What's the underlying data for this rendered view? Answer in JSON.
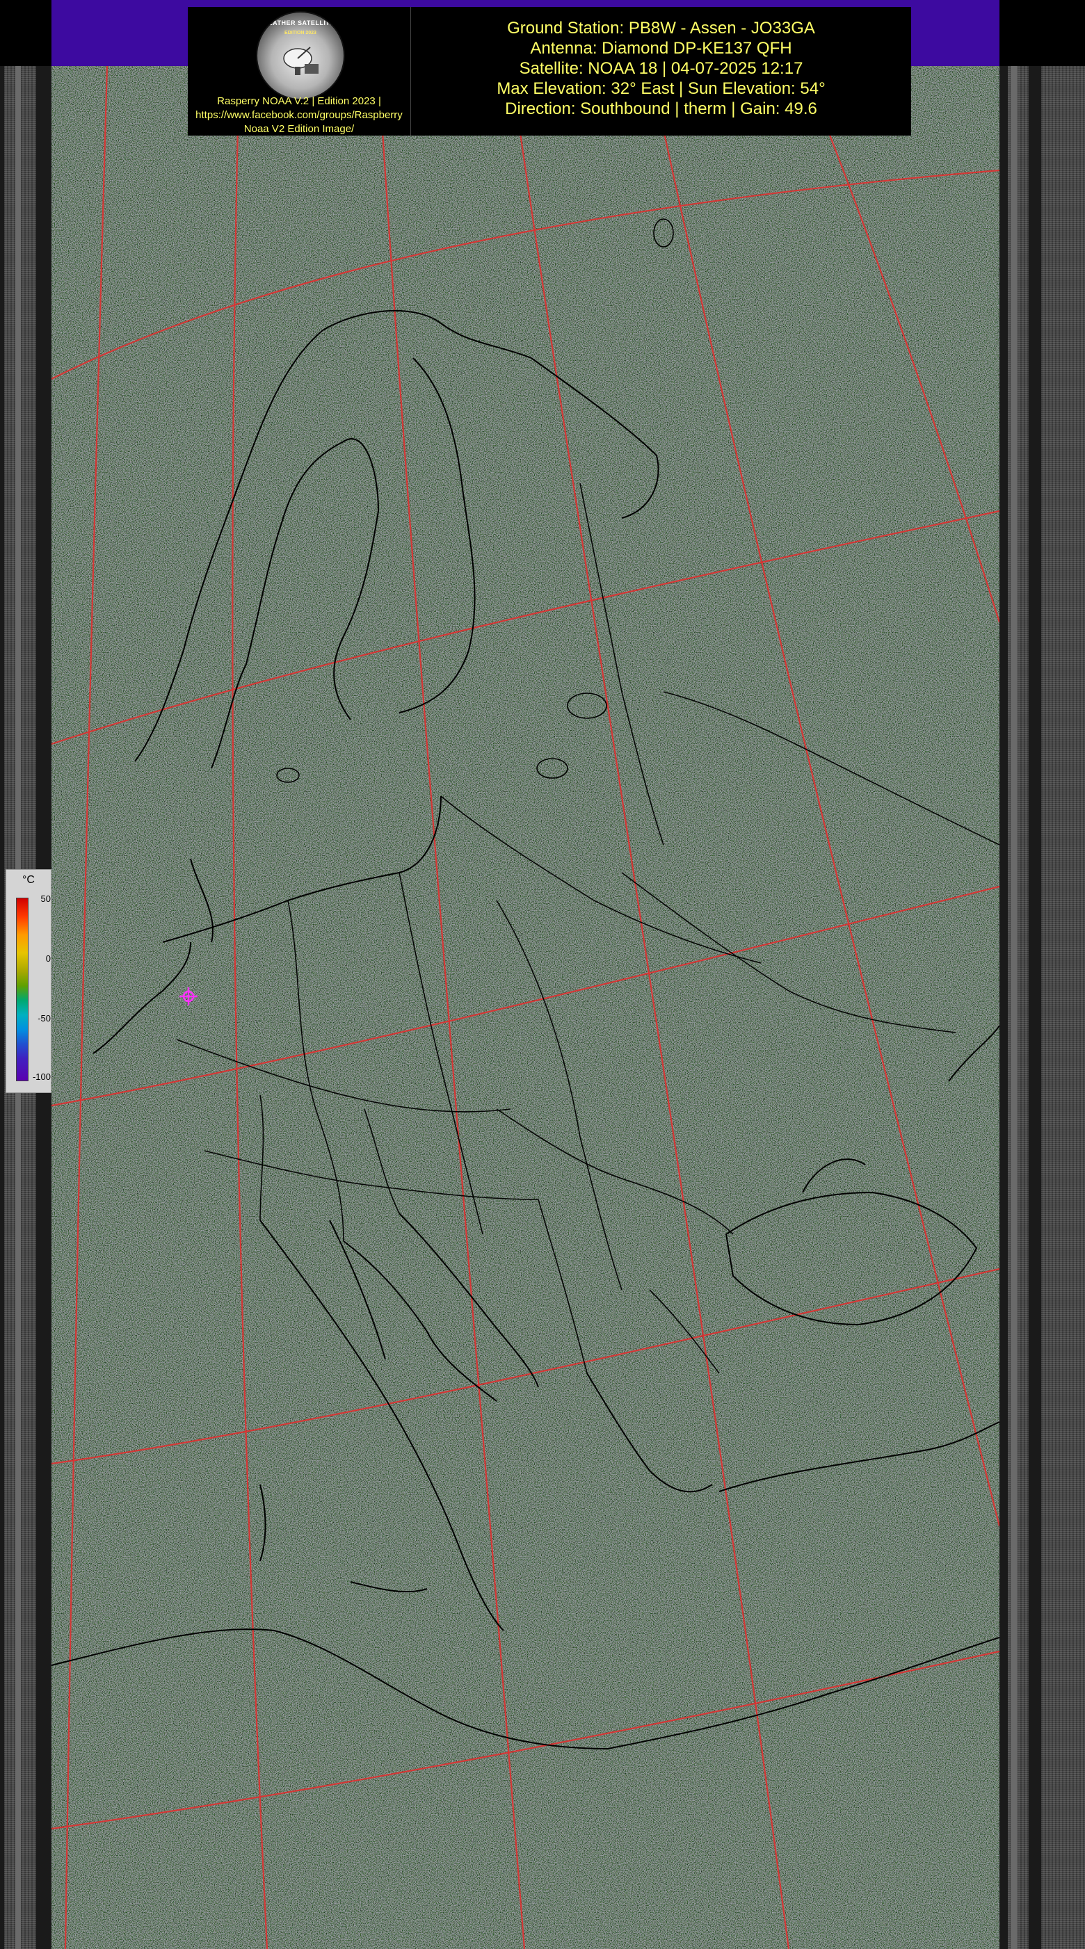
{
  "credits": {
    "logo_ring_text": "WEATHER SATELLITES",
    "logo_edition": "EDITION 2023",
    "line1": "Rasperry NOAA V.2 | Edition 2023 |",
    "line2": "https://www.facebook.com/groups/Raspberry",
    "line3": "Noaa V2 Edition Image/"
  },
  "header": {
    "line1": "Ground Station: PB8W - Assen - JO33GA",
    "line2": "Antenna: Diamond DP-KE137 QFH",
    "line3": "Satellite: NOAA 18 | 04-07-2025 12:17",
    "line4": "Max Elevation: 32° East | Sun Elevation: 54°",
    "line5": "Direction: Southbound | therm | Gain: 49.6"
  },
  "legend": {
    "unit": "°C",
    "labels": [
      "50",
      "0",
      "-50",
      "-100"
    ],
    "colors": [
      "#d00000",
      "#ff9a00",
      "#a8a800",
      "#00a870",
      "#0090e0",
      "#5a00b0"
    ]
  },
  "colors": {
    "band": "#3d0aa0",
    "header_text": "#ffff66",
    "graticule": "#e03030",
    "borders": "#000000",
    "station_marker": "#ff33ff"
  },
  "icons": {
    "station_marker": "crosshair-icon",
    "logo": "satellite-dish-icon"
  }
}
